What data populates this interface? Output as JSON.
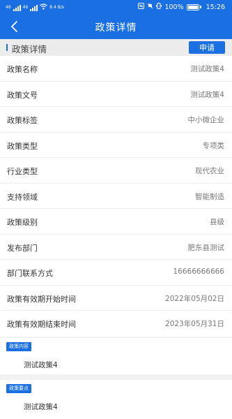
{
  "status_bar": {
    "net_left": "46",
    "net_right": "46",
    "speed": "8.4 B/s",
    "battery": "100%",
    "time": "15:26"
  },
  "nav": {
    "title": "政策详情"
  },
  "section": {
    "title": "政策详情",
    "apply_label": "申请"
  },
  "fields": [
    {
      "label": "政策名称",
      "value": "测试政策4"
    },
    {
      "label": "政策文号",
      "value": "测试政策4"
    },
    {
      "label": "政策标签",
      "value": "中小微企业"
    },
    {
      "label": "政策类型",
      "value": "专项类"
    },
    {
      "label": "行业类型",
      "value": "现代农业"
    },
    {
      "label": "支持领域",
      "value": "智能制造"
    },
    {
      "label": "政策级别",
      "value": "县级"
    },
    {
      "label": "发布部门",
      "value": "肥东县测试"
    },
    {
      "label": "部门联系方式",
      "value": "16666666666"
    },
    {
      "label": "政策有效期开始时间",
      "value": "2022年05月02日"
    },
    {
      "label": "政策有效期结束时间",
      "value": "2023年05月31日"
    }
  ],
  "content_card": {
    "tag": "政策内容",
    "text": "测试政策4"
  },
  "points_card": {
    "tag": "政策要点",
    "text": "测试政策4"
  },
  "colors": {
    "primary": "#1a6fe3",
    "background": "#f2f2f2"
  }
}
